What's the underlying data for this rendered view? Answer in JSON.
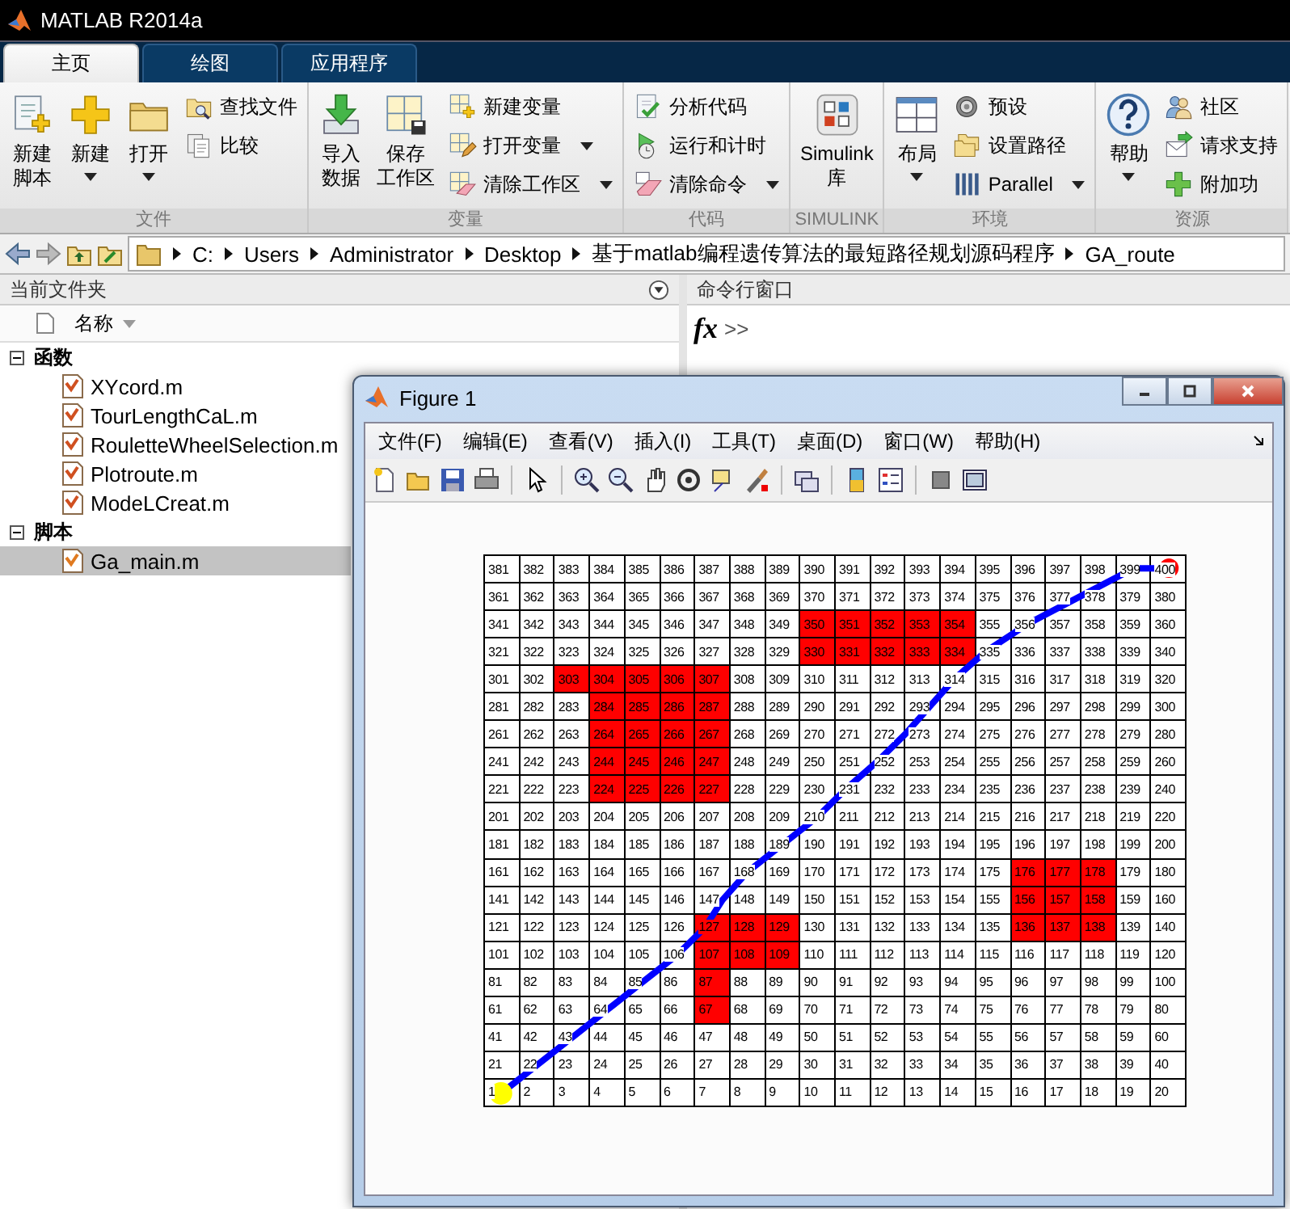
{
  "window": {
    "title": "MATLAB R2014a"
  },
  "tabs": [
    {
      "label": "主页",
      "selected": true
    },
    {
      "label": "绘图",
      "selected": false
    },
    {
      "label": "应用程序",
      "selected": false
    }
  ],
  "ribbon": {
    "groups": [
      {
        "label": "文件",
        "large": [
          {
            "lines": [
              "新建",
              "脚本"
            ],
            "dropdown": false
          },
          {
            "lines": [
              "新建"
            ],
            "dropdown": true
          },
          {
            "lines": [
              "打开"
            ],
            "dropdown": true
          }
        ],
        "small": [
          {
            "label": "查找文件",
            "dropdown": false
          },
          {
            "label": "比较",
            "dropdown": false
          }
        ]
      },
      {
        "label": "变量",
        "large": [
          {
            "lines": [
              "导入",
              "数据"
            ],
            "dropdown": false
          },
          {
            "lines": [
              "保存",
              "工作区"
            ],
            "dropdown": false
          }
        ],
        "small": [
          {
            "label": "新建变量",
            "dropdown": false
          },
          {
            "label": "打开变量",
            "dropdown": true
          },
          {
            "label": "清除工作区",
            "dropdown": true
          }
        ]
      },
      {
        "label": "代码",
        "small": [
          {
            "label": "分析代码",
            "dropdown": false
          },
          {
            "label": "运行和计时",
            "dropdown": false
          },
          {
            "label": "清除命令",
            "dropdown": true
          }
        ]
      },
      {
        "label": "SIMULINK",
        "large": [
          {
            "lines": [
              "Simulink",
              "库"
            ],
            "dropdown": false
          }
        ]
      },
      {
        "label": "环境",
        "large": [
          {
            "lines": [
              "布局"
            ],
            "dropdown": true
          }
        ],
        "small": [
          {
            "label": "预设",
            "dropdown": false
          },
          {
            "label": "设置路径",
            "dropdown": false
          },
          {
            "label": "Parallel",
            "dropdown": true
          }
        ]
      },
      {
        "label": "资源",
        "large": [
          {
            "lines": [
              "帮助"
            ],
            "dropdown": true
          }
        ],
        "small": [
          {
            "label": "社区",
            "dropdown": false
          },
          {
            "label": "请求支持",
            "dropdown": false
          },
          {
            "label": "附加功",
            "dropdown": false
          }
        ]
      }
    ]
  },
  "address": {
    "path": [
      "C:",
      "Users",
      "Administrator",
      "Desktop",
      "基于matlab编程遗传算法的最短路径规划源码程序",
      "GA_route"
    ]
  },
  "current_folder": {
    "title": "当前文件夹",
    "column": "名称",
    "sections": [
      {
        "label": "函数",
        "expanded": true,
        "children": [
          {
            "name": "XYcord.m",
            "selected": false
          },
          {
            "name": "TourLengthCaL.m",
            "selected": false
          },
          {
            "name": "RouletteWheelSelection.m",
            "selected": false
          },
          {
            "name": "Plotroute.m",
            "selected": false
          },
          {
            "name": "ModeLCreat.m",
            "selected": false
          }
        ]
      },
      {
        "label": "脚本",
        "expanded": true,
        "children": [
          {
            "name": "Ga_main.m",
            "selected": true
          }
        ]
      }
    ]
  },
  "command_window": {
    "title": "命令行窗口",
    "function_button": "fx",
    "prompt": ">>"
  },
  "figure": {
    "title": "Figure 1",
    "menu": [
      "文件(F)",
      "编辑(E)",
      "查看(V)",
      "插入(I)",
      "工具(T)",
      "桌面(D)",
      "窗口(W)",
      "帮助(H)"
    ],
    "grid": [
      {
        "cells": [
          "381",
          "382",
          "383",
          "384",
          "385",
          "386",
          "387",
          "388",
          "389",
          "390",
          "391",
          "392",
          "393",
          "394",
          "395",
          "396",
          "397",
          "398",
          "399",
          "400"
        ],
        "blocked": [
          false,
          false,
          false,
          false,
          false,
          false,
          false,
          false,
          false,
          false,
          false,
          false,
          false,
          false,
          false,
          false,
          false,
          false,
          false,
          false
        ]
      },
      {
        "cells": [
          "361",
          "362",
          "363",
          "364",
          "365",
          "366",
          "367",
          "368",
          "369",
          "370",
          "371",
          "372",
          "373",
          "374",
          "375",
          "376",
          "377",
          "378",
          "379",
          "380"
        ],
        "blocked": [
          false,
          false,
          false,
          false,
          false,
          false,
          false,
          false,
          false,
          false,
          false,
          false,
          false,
          false,
          false,
          false,
          false,
          false,
          false,
          false
        ]
      },
      {
        "cells": [
          "341",
          "342",
          "343",
          "344",
          "345",
          "346",
          "347",
          "348",
          "349",
          "350",
          "351",
          "352",
          "353",
          "354",
          "355",
          "356",
          "357",
          "358",
          "359",
          "360"
        ],
        "blocked": [
          false,
          false,
          false,
          false,
          false,
          false,
          false,
          false,
          false,
          true,
          true,
          true,
          true,
          true,
          false,
          false,
          false,
          false,
          false,
          false
        ]
      },
      {
        "cells": [
          "321",
          "322",
          "323",
          "324",
          "325",
          "326",
          "327",
          "328",
          "329",
          "330",
          "331",
          "332",
          "333",
          "334",
          "335",
          "336",
          "337",
          "338",
          "339",
          "340"
        ],
        "blocked": [
          false,
          false,
          false,
          false,
          false,
          false,
          false,
          false,
          false,
          true,
          true,
          true,
          true,
          true,
          false,
          false,
          false,
          false,
          false,
          false
        ]
      },
      {
        "cells": [
          "301",
          "302",
          "303",
          "304",
          "305",
          "306",
          "307",
          "308",
          "309",
          "310",
          "311",
          "312",
          "313",
          "314",
          "315",
          "316",
          "317",
          "318",
          "319",
          "320"
        ],
        "blocked": [
          false,
          false,
          true,
          true,
          true,
          true,
          true,
          false,
          false,
          false,
          false,
          false,
          false,
          false,
          false,
          false,
          false,
          false,
          false,
          false
        ]
      },
      {
        "cells": [
          "281",
          "282",
          "283",
          "284",
          "285",
          "286",
          "287",
          "288",
          "289",
          "290",
          "291",
          "292",
          "293",
          "294",
          "295",
          "296",
          "297",
          "298",
          "299",
          "300"
        ],
        "blocked": [
          false,
          false,
          false,
          true,
          true,
          true,
          true,
          false,
          false,
          false,
          false,
          false,
          false,
          false,
          false,
          false,
          false,
          false,
          false,
          false
        ]
      },
      {
        "cells": [
          "261",
          "262",
          "263",
          "264",
          "265",
          "266",
          "267",
          "268",
          "269",
          "270",
          "271",
          "272",
          "273",
          "274",
          "275",
          "276",
          "277",
          "278",
          "279",
          "280"
        ],
        "blocked": [
          false,
          false,
          false,
          true,
          true,
          true,
          true,
          false,
          false,
          false,
          false,
          false,
          false,
          false,
          false,
          false,
          false,
          false,
          false,
          false
        ]
      },
      {
        "cells": [
          "241",
          "242",
          "243",
          "244",
          "245",
          "246",
          "247",
          "248",
          "249",
          "250",
          "251",
          "252",
          "253",
          "254",
          "255",
          "256",
          "257",
          "258",
          "259",
          "260"
        ],
        "blocked": [
          false,
          false,
          false,
          true,
          true,
          true,
          true,
          false,
          false,
          false,
          false,
          false,
          false,
          false,
          false,
          false,
          false,
          false,
          false,
          false
        ]
      },
      {
        "cells": [
          "221",
          "222",
          "223",
          "224",
          "225",
          "226",
          "227",
          "228",
          "229",
          "230",
          "231",
          "232",
          "233",
          "234",
          "235",
          "236",
          "237",
          "238",
          "239",
          "240"
        ],
        "blocked": [
          false,
          false,
          false,
          true,
          true,
          true,
          true,
          false,
          false,
          false,
          false,
          false,
          false,
          false,
          false,
          false,
          false,
          false,
          false,
          false
        ]
      },
      {
        "cells": [
          "201",
          "202",
          "203",
          "204",
          "205",
          "206",
          "207",
          "208",
          "209",
          "210",
          "211",
          "212",
          "213",
          "214",
          "215",
          "216",
          "217",
          "218",
          "219",
          "220"
        ],
        "blocked": [
          false,
          false,
          false,
          false,
          false,
          false,
          false,
          false,
          false,
          false,
          false,
          false,
          false,
          false,
          false,
          false,
          false,
          false,
          false,
          false
        ]
      },
      {
        "cells": [
          "181",
          "182",
          "183",
          "184",
          "185",
          "186",
          "187",
          "188",
          "189",
          "190",
          "191",
          "192",
          "193",
          "194",
          "195",
          "196",
          "197",
          "198",
          "199",
          "200"
        ],
        "blocked": [
          false,
          false,
          false,
          false,
          false,
          false,
          false,
          false,
          false,
          false,
          false,
          false,
          false,
          false,
          false,
          false,
          false,
          false,
          false,
          false
        ]
      },
      {
        "cells": [
          "161",
          "162",
          "163",
          "164",
          "165",
          "166",
          "167",
          "168",
          "169",
          "170",
          "171",
          "172",
          "173",
          "174",
          "175",
          "176",
          "177",
          "178",
          "179",
          "180"
        ],
        "blocked": [
          false,
          false,
          false,
          false,
          false,
          false,
          false,
          false,
          false,
          false,
          false,
          false,
          false,
          false,
          false,
          true,
          true,
          true,
          false,
          false
        ]
      },
      {
        "cells": [
          "141",
          "142",
          "143",
          "144",
          "145",
          "146",
          "147",
          "148",
          "149",
          "150",
          "151",
          "152",
          "153",
          "154",
          "155",
          "156",
          "157",
          "158",
          "159",
          "160"
        ],
        "blocked": [
          false,
          false,
          false,
          false,
          false,
          false,
          false,
          false,
          false,
          false,
          false,
          false,
          false,
          false,
          false,
          true,
          true,
          true,
          false,
          false
        ]
      },
      {
        "cells": [
          "121",
          "122",
          "123",
          "124",
          "125",
          "126",
          "127",
          "128",
          "129",
          "130",
          "131",
          "132",
          "133",
          "134",
          "135",
          "136",
          "137",
          "138",
          "139",
          "140"
        ],
        "blocked": [
          false,
          false,
          false,
          false,
          false,
          false,
          true,
          true,
          true,
          false,
          false,
          false,
          false,
          false,
          false,
          true,
          true,
          true,
          false,
          false
        ]
      },
      {
        "cells": [
          "101",
          "102",
          "103",
          "104",
          "105",
          "106",
          "107",
          "108",
          "109",
          "110",
          "111",
          "112",
          "113",
          "114",
          "115",
          "116",
          "117",
          "118",
          "119",
          "120"
        ],
        "blocked": [
          false,
          false,
          false,
          false,
          false,
          false,
          true,
          true,
          true,
          false,
          false,
          false,
          false,
          false,
          false,
          false,
          false,
          false,
          false,
          false
        ]
      },
      {
        "cells": [
          "81",
          "82",
          "83",
          "84",
          "85",
          "86",
          "87",
          "88",
          "89",
          "90",
          "91",
          "92",
          "93",
          "94",
          "95",
          "96",
          "97",
          "98",
          "99",
          "100"
        ],
        "blocked": [
          false,
          false,
          false,
          false,
          false,
          false,
          true,
          false,
          false,
          false,
          false,
          false,
          false,
          false,
          false,
          false,
          false,
          false,
          false,
          false
        ]
      },
      {
        "cells": [
          "61",
          "62",
          "63",
          "64",
          "65",
          "66",
          "67",
          "68",
          "69",
          "70",
          "71",
          "72",
          "73",
          "74",
          "75",
          "76",
          "77",
          "78",
          "79",
          "80"
        ],
        "blocked": [
          false,
          false,
          false,
          false,
          false,
          false,
          true,
          false,
          false,
          false,
          false,
          false,
          false,
          false,
          false,
          false,
          false,
          false,
          false,
          false
        ]
      },
      {
        "cells": [
          "41",
          "42",
          "43",
          "44",
          "45",
          "46",
          "47",
          "48",
          "49",
          "50",
          "51",
          "52",
          "53",
          "54",
          "55",
          "56",
          "57",
          "58",
          "59",
          "60"
        ],
        "blocked": [
          false,
          false,
          false,
          false,
          false,
          false,
          false,
          false,
          false,
          false,
          false,
          false,
          false,
          false,
          false,
          false,
          false,
          false,
          false,
          false
        ]
      },
      {
        "cells": [
          "21",
          "22",
          "23",
          "24",
          "25",
          "26",
          "27",
          "28",
          "29",
          "30",
          "31",
          "32",
          "33",
          "34",
          "35",
          "36",
          "37",
          "38",
          "39",
          "40"
        ],
        "blocked": [
          false,
          false,
          false,
          false,
          false,
          false,
          false,
          false,
          false,
          false,
          false,
          false,
          false,
          false,
          false,
          false,
          false,
          false,
          false,
          false
        ]
      },
      {
        "cells": [
          "1",
          "2",
          "3",
          "4",
          "5",
          "6",
          "7",
          "8",
          "9",
          "10",
          "11",
          "12",
          "13",
          "14",
          "15",
          "16",
          "17",
          "18",
          "19",
          "20"
        ],
        "blocked": [
          false,
          false,
          false,
          false,
          false,
          false,
          false,
          false,
          false,
          false,
          false,
          false,
          false,
          false,
          false,
          false,
          false,
          false,
          false,
          false
        ]
      }
    ]
  }
}
